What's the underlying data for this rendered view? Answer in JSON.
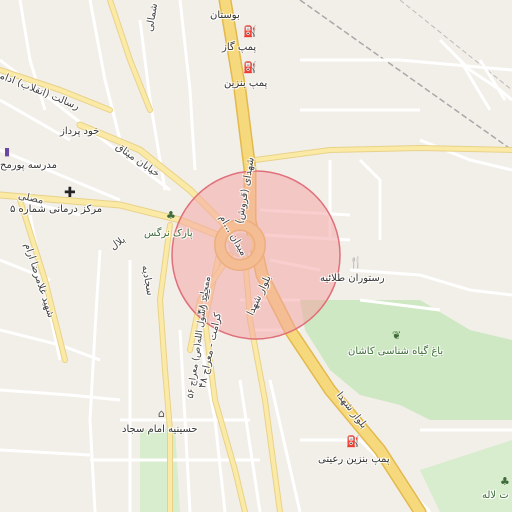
{
  "map": {
    "colors": {
      "background": "#f2efe9",
      "major_road": "#f7d97d",
      "major_road_casing": "#e3b94e",
      "minor_road": "#ffffff",
      "minor_road_casing": "#d9d4cc",
      "park": "#cfe8c4",
      "highlight_fill": "#f4a6a6",
      "highlight_stroke": "#e0707a",
      "railway": "#a8a8a8"
    },
    "places": [
      {
        "id": "bostan",
        "label": "بوستان"
      },
      {
        "id": "pump-gas",
        "label": "پمپ گاز",
        "icon": "fuel-icon"
      },
      {
        "id": "pump-benzin",
        "label": "پمپ بنزین",
        "icon": "fuel-icon"
      },
      {
        "id": "khodpardaz",
        "label": "خود پرداز"
      },
      {
        "id": "school",
        "label": "مدرسه پورمح",
        "icon": "school-icon"
      },
      {
        "id": "clinic",
        "label": "مرکز درمانی شماره ۵",
        "icon": "hospital-icon"
      },
      {
        "id": "park-narges",
        "label": "پارک نرگس",
        "icon": "tree-icon"
      },
      {
        "id": "talaiye",
        "label": "رستوران طلائیه",
        "icon": "restaurant-icon"
      },
      {
        "id": "botanical",
        "label": "باغ گیاه شناسی کاشان",
        "icon": "garden-icon"
      },
      {
        "id": "hosseiniyeh",
        "label": "حسینیه امام سجاد",
        "icon": "mosque-icon"
      },
      {
        "id": "raiati",
        "label": "پمپ بنزین رعیتی",
        "icon": "fuel-icon"
      },
      {
        "id": "laleh",
        "label": "ت لاله",
        "icon": "tree-icon"
      }
    ],
    "roads": [
      {
        "id": "shomali",
        "label": "شمالی"
      },
      {
        "id": "resalat",
        "label": "رسالت (انقلاب) ادامه"
      },
      {
        "id": "mitaq",
        "label": "خیابان میثاق"
      },
      {
        "id": "mosalla",
        "label": "مصلی"
      },
      {
        "id": "bilal",
        "label": "بلال"
      },
      {
        "id": "ghomasra",
        "label": "شهید غلامرضا ارام"
      },
      {
        "id": "sajjadieh",
        "label": "سجادیه"
      },
      {
        "id": "meydan",
        "label": "میدان ...ام"
      },
      {
        "id": "meydan-ghorbani",
        "label": "شهدای (قروش)"
      },
      {
        "id": "bolvar-shohada-1",
        "label": "بلوار شهدا"
      },
      {
        "id": "bolvar-shohada-2",
        "label": "بلوار شهدا"
      },
      {
        "id": "meraj-48",
        "label": "معراج ۴۸"
      },
      {
        "id": "karamet-meraj",
        "label": "کرامت - معراج ۴۸"
      },
      {
        "id": "mohammad-rasul",
        "label": "محمد رسول الله(ص) معراج ۵۶"
      }
    ]
  }
}
